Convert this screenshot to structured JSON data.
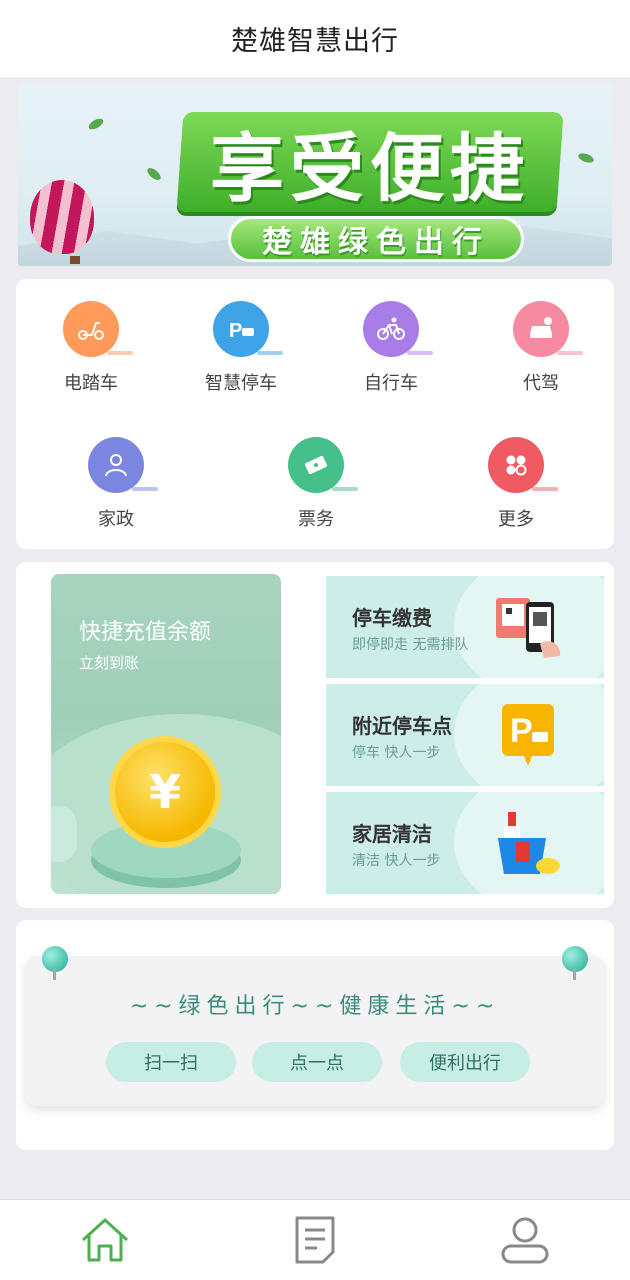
{
  "header": {
    "title": "楚雄智慧出行"
  },
  "banner": {
    "headline": "享受便捷",
    "subline": "楚雄绿色出行"
  },
  "services": [
    {
      "label": "电踏车",
      "icon": "scooter-icon",
      "color": "#ff9a5a"
    },
    {
      "label": "智慧停车",
      "icon": "parking-icon",
      "color": "#3fa3e8"
    },
    {
      "label": "自行车",
      "icon": "bicycle-icon",
      "color": "#a97de8"
    },
    {
      "label": "代驾",
      "icon": "car-icon",
      "color": "#f58aa0"
    },
    {
      "label": "家政",
      "icon": "housekeeper-icon",
      "color": "#7b86e0"
    },
    {
      "label": "票务",
      "icon": "ticket-icon",
      "color": "#46c08a"
    },
    {
      "label": "更多",
      "icon": "more-icon",
      "color": "#f05a63"
    }
  ],
  "recharge": {
    "title": "快捷充值余额",
    "subtitle": "立刻到账",
    "symbol": "¥"
  },
  "tiles": [
    {
      "title": "停车缴费",
      "subtitle": "即停即走 无需排队",
      "icon": "qr-phone-icon"
    },
    {
      "title": "附近停车点",
      "subtitle": "停车 快人一步",
      "icon": "parking-sign-icon"
    },
    {
      "title": "家居清洁",
      "subtitle": "清洁 快人一步",
      "icon": "cleaning-bucket-icon"
    }
  ],
  "slogan": {
    "text": "~~绿色出行~~健康生活~~",
    "buttons": [
      "扫一扫",
      "点一点",
      "便利出行"
    ]
  },
  "tabbar": {
    "items": [
      "home-icon",
      "list-icon",
      "profile-icon"
    ],
    "accent": "#4caf50"
  }
}
